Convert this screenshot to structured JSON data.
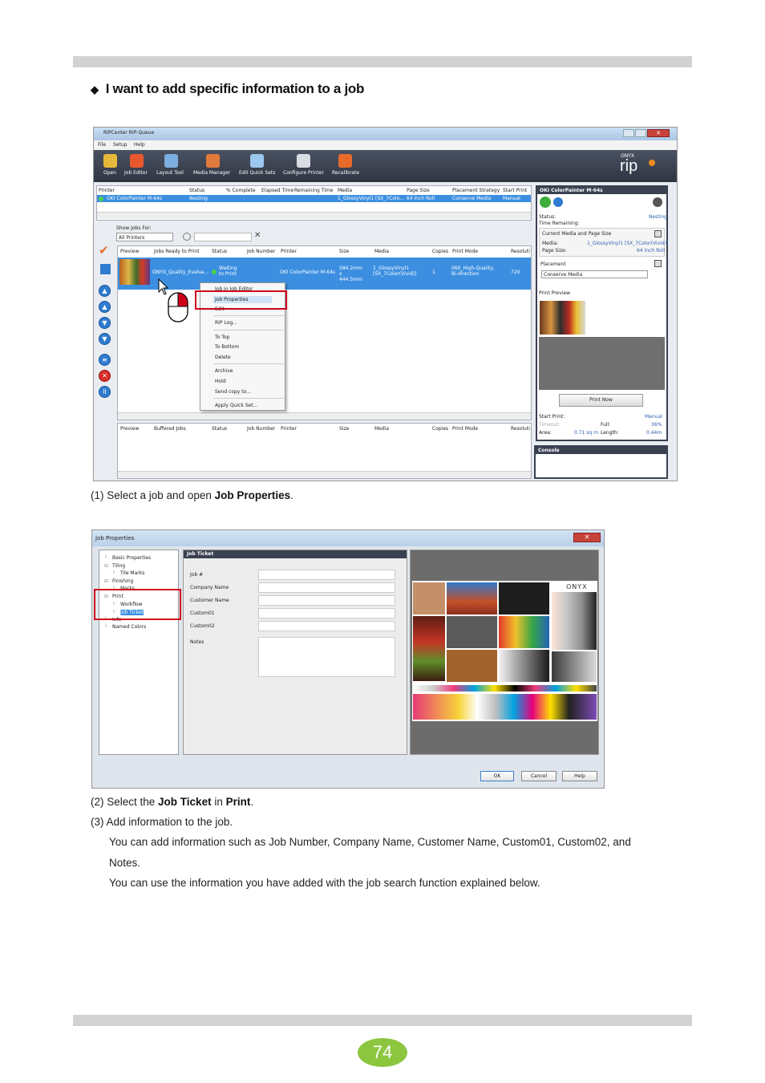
{
  "heading": "I want to add specific information to a job",
  "page_number": "74",
  "colors": {
    "bar": "#d2d2d2",
    "page_badge": "#8cc63f",
    "highlight": "#d0021b",
    "selection": "#3c8fe0",
    "toolbar": "#3a4150"
  },
  "screenshot1": {
    "window_title": "RIPCenter RIP-Queue",
    "menu": [
      "File",
      "Setup",
      "Help"
    ],
    "toolbar": [
      "Open",
      "Job Editor",
      "Layout Tool",
      "Media Manager",
      "Edit Quick Sets",
      "Configure Printer",
      "Recalibrate"
    ],
    "brand_small": "ONYX",
    "brand_big": "rip",
    "printer_table": {
      "headers": [
        "Printer",
        "Status",
        "% Complete",
        "Elapsed Time",
        "Remaining Time",
        "Media",
        "Page Size",
        "Placement Strategy",
        "Start Print"
      ],
      "row": [
        "OKI ColorPainter M-64s",
        "Nesting",
        "",
        "",
        "",
        "1_GlossyVinyl1 [SX_7Colo...",
        "64 Inch Roll",
        "Conserve Media",
        "Manual"
      ]
    },
    "show_jobs_label": "Show Jobs For:",
    "show_jobs_value": "All Printers",
    "jobs_headers": [
      "Preview",
      "Jobs Ready to Print",
      "Status",
      "Job Number",
      "Printer",
      "Size",
      "Media",
      "Copies",
      "Print Mode",
      "Resoluti"
    ],
    "job_row": {
      "name": "ONYX_Quality_Evalua...",
      "status": "Waiting to Print",
      "printer": "OKI ColorPainter M-64s",
      "size": "584.2mm x 444.5mm",
      "media": "1_GlossyVinyl1 [SX_7Color(Vivid)]",
      "copies": "1",
      "print_mode": "060_High-Quality, Bi-direction",
      "resolution": "720"
    },
    "context_menu": [
      "Job in Job Editor",
      "Job Properties",
      "Edit",
      "RIP Log...",
      "To Top",
      "To Bottom",
      "Delete",
      "Archive",
      "Hold",
      "Send copy to...",
      "Apply Quick Set..."
    ],
    "buffered_headers": [
      "Preview",
      "Buffered Jobs",
      "Status",
      "Job Number",
      "Printer",
      "Size",
      "Media",
      "Copies",
      "Print Mode",
      "Resoluti"
    ],
    "right_panel": {
      "printer_title": "OKI ColorPainter M-64s",
      "status_label": "Status:",
      "status_value": "Nesting",
      "time_label": "Time Remaining:",
      "media_section": "Current Media and Page Size",
      "media_label": "Media:",
      "media_value": "1_GlossyVinyl1 [SX_7Color(Vivid)]",
      "page_label": "Page Size:",
      "page_value": "64 Inch Roll",
      "placement_label": "Placement",
      "placement_value": "Conserve Media",
      "preview_label": "Print Preview",
      "print_now": "Print Now",
      "start_label": "Start Print:",
      "start_value": "Manual",
      "timeout_label": "Timeout:",
      "full_label": "Full:",
      "full_value": "36%",
      "area_label": "Area:",
      "area_value": "0.71 sq m",
      "length_label": "Length:",
      "length_value": "0.44m",
      "console_label": "Console"
    }
  },
  "caption1": {
    "prefix": "(1)  Select a job and open ",
    "bold": "Job Properties",
    "suffix": "."
  },
  "screenshot2": {
    "window_title": "Job Properties",
    "tree": [
      "Basic Properties",
      "Tiling",
      "Tile Marks",
      "Finishing",
      "Marks",
      "Print",
      "Workflow",
      "Job Ticket",
      "Info",
      "Named Colors"
    ],
    "panel_title": "Job Ticket",
    "fields": [
      "Job #",
      "Company Name",
      "Customer Name",
      "Custom01",
      "Custom02",
      "Notes"
    ],
    "brand": "ONYX",
    "buttons": [
      "OK",
      "Cancel",
      "Help"
    ]
  },
  "caption2": {
    "prefix": "(2)  Select the ",
    "bold1": "Job Ticket",
    "mid": " in ",
    "bold2": "Print",
    "suffix": "."
  },
  "caption3": "(3)  Add information to the job.",
  "para1_line1": "You can add information such as Job Number, Company Name, Customer Name, Custom01, Custom02, and",
  "para1_line2": "Notes.",
  "para2": "You can use the information you have added with the job search function explained below."
}
